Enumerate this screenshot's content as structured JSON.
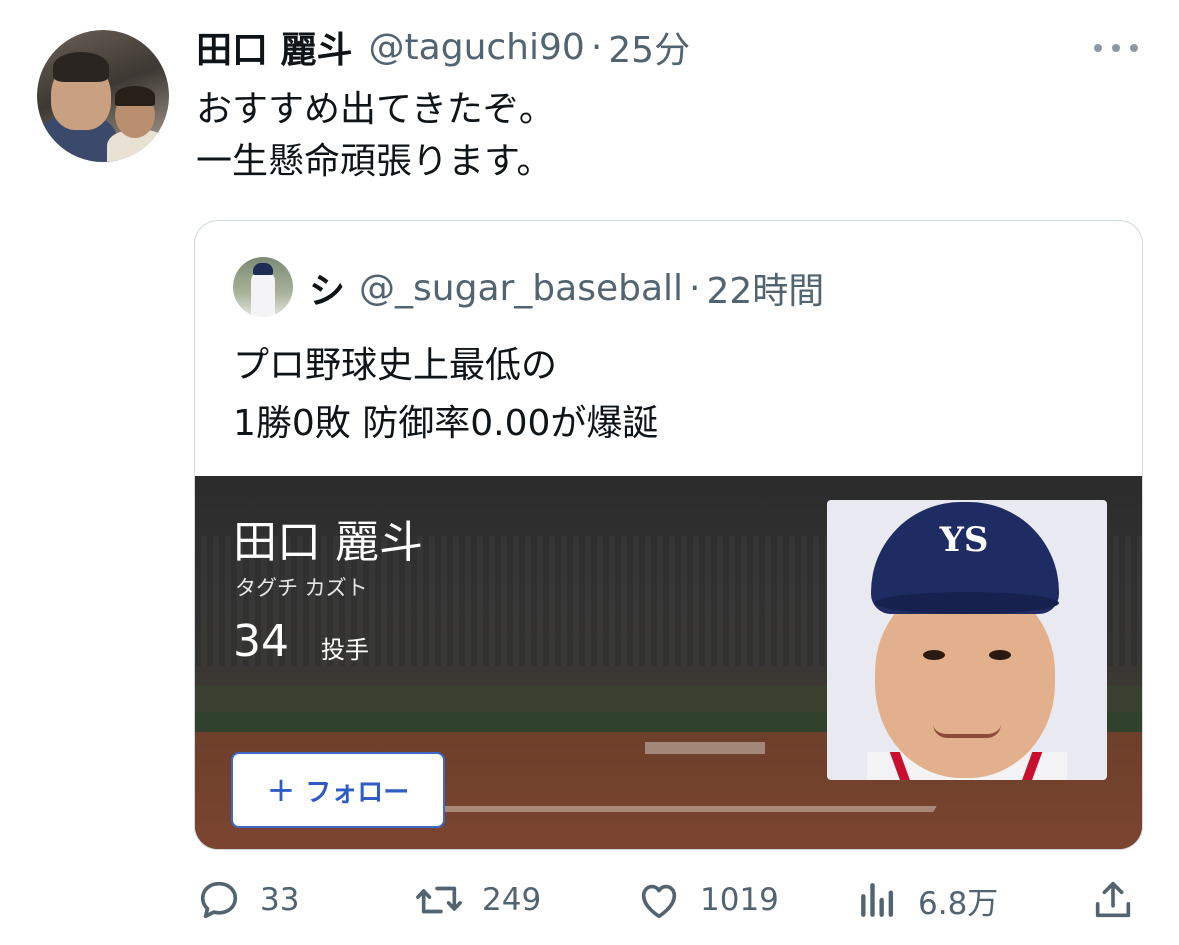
{
  "tweet": {
    "author_name": "田口 麗斗",
    "handle": "@taguchi90",
    "separator": "·",
    "time": "25分",
    "lines": [
      "おすすめ出てきたぞ。",
      "一生懸命頑張ります。"
    ]
  },
  "quote": {
    "author_name": "シ",
    "handle": "@_sugar_baseball",
    "separator": "·",
    "time": "22時間",
    "lines": [
      "プロ野球史上最低の",
      "1勝0敗 防御率0.00が爆誕"
    ],
    "card": {
      "player_name": "田口 麗斗",
      "player_kana": "タグチ カズト",
      "number": "34",
      "position": "投手",
      "follow_plus": "+",
      "follow_label": "フォロー"
    }
  },
  "actions": {
    "replies": "33",
    "retweets": "249",
    "likes": "1019",
    "views": "6.8万"
  },
  "icons": {
    "more": "more-horizontal-icon",
    "reply": "reply-icon",
    "retweet": "retweet-icon",
    "like": "heart-icon",
    "views": "views-icon",
    "share": "share-icon"
  },
  "colors": {
    "text": "#0f1419",
    "secondary": "#536471",
    "follow_accent": "#2f5cc4",
    "border": "#cfd9de"
  }
}
